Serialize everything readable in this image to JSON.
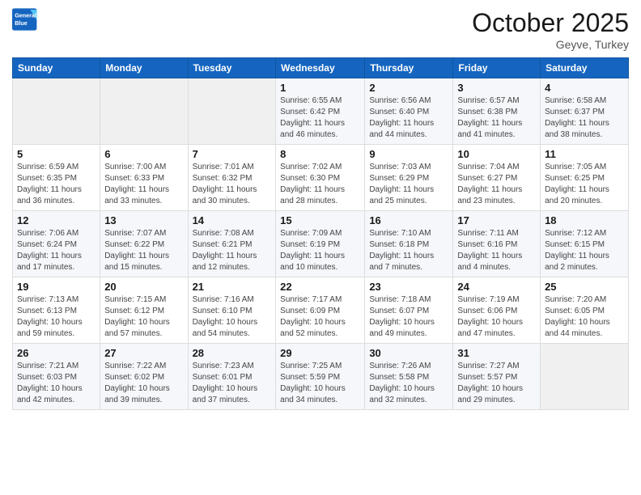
{
  "header": {
    "logo_line1": "General",
    "logo_line2": "Blue",
    "month": "October 2025",
    "location": "Geyve, Turkey"
  },
  "days_of_week": [
    "Sunday",
    "Monday",
    "Tuesday",
    "Wednesday",
    "Thursday",
    "Friday",
    "Saturday"
  ],
  "weeks": [
    [
      {
        "day": "",
        "info": ""
      },
      {
        "day": "",
        "info": ""
      },
      {
        "day": "",
        "info": ""
      },
      {
        "day": "1",
        "info": "Sunrise: 6:55 AM\nSunset: 6:42 PM\nDaylight: 11 hours\nand 46 minutes."
      },
      {
        "day": "2",
        "info": "Sunrise: 6:56 AM\nSunset: 6:40 PM\nDaylight: 11 hours\nand 44 minutes."
      },
      {
        "day": "3",
        "info": "Sunrise: 6:57 AM\nSunset: 6:38 PM\nDaylight: 11 hours\nand 41 minutes."
      },
      {
        "day": "4",
        "info": "Sunrise: 6:58 AM\nSunset: 6:37 PM\nDaylight: 11 hours\nand 38 minutes."
      }
    ],
    [
      {
        "day": "5",
        "info": "Sunrise: 6:59 AM\nSunset: 6:35 PM\nDaylight: 11 hours\nand 36 minutes."
      },
      {
        "day": "6",
        "info": "Sunrise: 7:00 AM\nSunset: 6:33 PM\nDaylight: 11 hours\nand 33 minutes."
      },
      {
        "day": "7",
        "info": "Sunrise: 7:01 AM\nSunset: 6:32 PM\nDaylight: 11 hours\nand 30 minutes."
      },
      {
        "day": "8",
        "info": "Sunrise: 7:02 AM\nSunset: 6:30 PM\nDaylight: 11 hours\nand 28 minutes."
      },
      {
        "day": "9",
        "info": "Sunrise: 7:03 AM\nSunset: 6:29 PM\nDaylight: 11 hours\nand 25 minutes."
      },
      {
        "day": "10",
        "info": "Sunrise: 7:04 AM\nSunset: 6:27 PM\nDaylight: 11 hours\nand 23 minutes."
      },
      {
        "day": "11",
        "info": "Sunrise: 7:05 AM\nSunset: 6:25 PM\nDaylight: 11 hours\nand 20 minutes."
      }
    ],
    [
      {
        "day": "12",
        "info": "Sunrise: 7:06 AM\nSunset: 6:24 PM\nDaylight: 11 hours\nand 17 minutes."
      },
      {
        "day": "13",
        "info": "Sunrise: 7:07 AM\nSunset: 6:22 PM\nDaylight: 11 hours\nand 15 minutes."
      },
      {
        "day": "14",
        "info": "Sunrise: 7:08 AM\nSunset: 6:21 PM\nDaylight: 11 hours\nand 12 minutes."
      },
      {
        "day": "15",
        "info": "Sunrise: 7:09 AM\nSunset: 6:19 PM\nDaylight: 11 hours\nand 10 minutes."
      },
      {
        "day": "16",
        "info": "Sunrise: 7:10 AM\nSunset: 6:18 PM\nDaylight: 11 hours\nand 7 minutes."
      },
      {
        "day": "17",
        "info": "Sunrise: 7:11 AM\nSunset: 6:16 PM\nDaylight: 11 hours\nand 4 minutes."
      },
      {
        "day": "18",
        "info": "Sunrise: 7:12 AM\nSunset: 6:15 PM\nDaylight: 11 hours\nand 2 minutes."
      }
    ],
    [
      {
        "day": "19",
        "info": "Sunrise: 7:13 AM\nSunset: 6:13 PM\nDaylight: 10 hours\nand 59 minutes."
      },
      {
        "day": "20",
        "info": "Sunrise: 7:15 AM\nSunset: 6:12 PM\nDaylight: 10 hours\nand 57 minutes."
      },
      {
        "day": "21",
        "info": "Sunrise: 7:16 AM\nSunset: 6:10 PM\nDaylight: 10 hours\nand 54 minutes."
      },
      {
        "day": "22",
        "info": "Sunrise: 7:17 AM\nSunset: 6:09 PM\nDaylight: 10 hours\nand 52 minutes."
      },
      {
        "day": "23",
        "info": "Sunrise: 7:18 AM\nSunset: 6:07 PM\nDaylight: 10 hours\nand 49 minutes."
      },
      {
        "day": "24",
        "info": "Sunrise: 7:19 AM\nSunset: 6:06 PM\nDaylight: 10 hours\nand 47 minutes."
      },
      {
        "day": "25",
        "info": "Sunrise: 7:20 AM\nSunset: 6:05 PM\nDaylight: 10 hours\nand 44 minutes."
      }
    ],
    [
      {
        "day": "26",
        "info": "Sunrise: 7:21 AM\nSunset: 6:03 PM\nDaylight: 10 hours\nand 42 minutes."
      },
      {
        "day": "27",
        "info": "Sunrise: 7:22 AM\nSunset: 6:02 PM\nDaylight: 10 hours\nand 39 minutes."
      },
      {
        "day": "28",
        "info": "Sunrise: 7:23 AM\nSunset: 6:01 PM\nDaylight: 10 hours\nand 37 minutes."
      },
      {
        "day": "29",
        "info": "Sunrise: 7:25 AM\nSunset: 5:59 PM\nDaylight: 10 hours\nand 34 minutes."
      },
      {
        "day": "30",
        "info": "Sunrise: 7:26 AM\nSunset: 5:58 PM\nDaylight: 10 hours\nand 32 minutes."
      },
      {
        "day": "31",
        "info": "Sunrise: 7:27 AM\nSunset: 5:57 PM\nDaylight: 10 hours\nand 29 minutes."
      },
      {
        "day": "",
        "info": ""
      }
    ]
  ]
}
